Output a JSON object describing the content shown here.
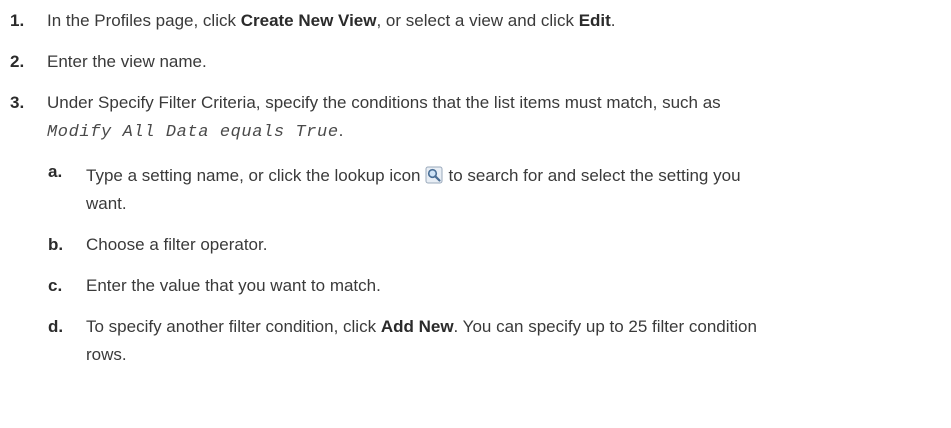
{
  "steps": [
    {
      "number": "1.",
      "pre": "In the Profiles page, click ",
      "bold1": "Create New View",
      "mid": ", or select a view and click ",
      "bold2": "Edit",
      "post": "."
    },
    {
      "number": "2.",
      "text": "Enter the view name."
    },
    {
      "number": "3.",
      "line1": "Under Specify Filter Criteria, specify the conditions that the list items must match, such as",
      "code": "Modify All Data equals True",
      "code_post": "."
    }
  ],
  "substeps": [
    {
      "letter": "a.",
      "pre": "Type a setting name, or click the lookup icon",
      "icon": "lookup-icon",
      "post": "to search for and select the setting you",
      "line2": "want."
    },
    {
      "letter": "b.",
      "text": "Choose a filter operator."
    },
    {
      "letter": "c.",
      "text": "Enter the value that you want to match."
    },
    {
      "letter": "d.",
      "pre": "To specify another filter condition, click ",
      "bold": "Add New",
      "post": ". You can specify up to 25 filter condition",
      "line2": "rows."
    }
  ]
}
